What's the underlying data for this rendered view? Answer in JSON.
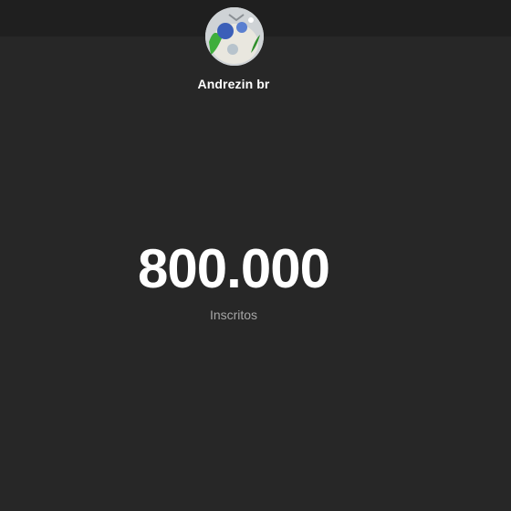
{
  "channel": {
    "name": "Andrezin br",
    "avatar_icon": "channel-avatar"
  },
  "stats": {
    "subscriber_count": "800.000",
    "subscriber_label": "Inscritos"
  },
  "colors": {
    "background": "#272727",
    "top_bar": "#1f1f1f",
    "count_text": "#ffffff",
    "label_text": "#a6a6a6"
  }
}
